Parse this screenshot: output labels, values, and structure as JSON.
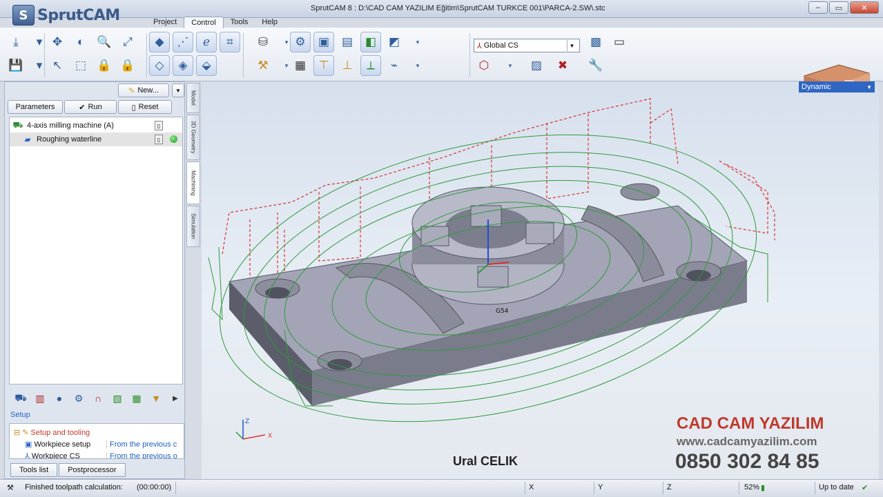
{
  "app": {
    "logo_text": "SprutCAM",
    "window_title": "SprutCAM 8 : D:\\CAD CAM YAZILIM Eğitim\\SprutCAM TURKCE 001\\PARCA-2.SW\\.stc",
    "menu_tabs": [
      "Project",
      "Control",
      "Tools",
      "Help"
    ]
  },
  "toolbar": {
    "coordinate_system": "Global CS",
    "view_mode": "Dynamic"
  },
  "left_panel": {
    "new_label": "New...",
    "parameters_label": "Parameters",
    "run_label": "Run",
    "reset_label": "Reset",
    "tree": [
      {
        "label": "4-axis milling machine (A)"
      },
      {
        "label": "Roughing waterline"
      }
    ],
    "vertical_tabs": [
      "Model",
      "3D Geometry",
      "Machining",
      "Simulation"
    ],
    "setup_label": "Setup",
    "setup_rows": [
      {
        "name": "Setup and tooling",
        "value": ""
      },
      {
        "name": "Workpiece setup",
        "value": "From the previous c"
      },
      {
        "name": "Workpiece CS",
        "value": "From the previous o"
      }
    ],
    "bottom_tabs": [
      "Tools list",
      "Postprocessor"
    ]
  },
  "viewport": {
    "axis_label_z": "Z",
    "axis_label_x": "X",
    "origin_label": "G54",
    "brand_cad": "CAD CAM ",
    "brand_yazilim": "YAZILIM",
    "website": "www.cadcamyazilim.com",
    "phone": "0850 302 84 85",
    "author": "Ural CELIK"
  },
  "status": {
    "message": "Finished toolpath calculation:",
    "time": "(00:00:00)",
    "x_label": "X",
    "y_label": "Y",
    "z_label": "Z",
    "percent": "52%",
    "update": "Up to date"
  },
  "colors": {
    "toolpath_green": "#2f9a3a",
    "rapid_red": "#d9302c",
    "part_gray": "#9ea0b0",
    "brand_red": "#c0392b"
  }
}
